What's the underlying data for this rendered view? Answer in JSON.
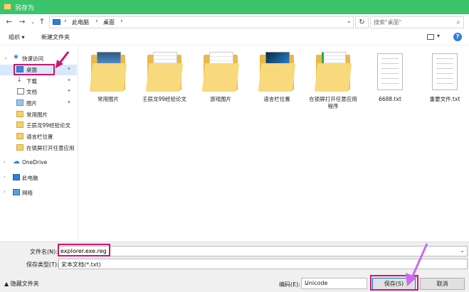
{
  "window": {
    "title": "另存为"
  },
  "address": {
    "crumbs": [
      "此电脑",
      "桌面"
    ],
    "search_placeholder": "搜索\"桌面\""
  },
  "toolbar": {
    "organize": "组织 ▾",
    "new_folder": "新建文件夹"
  },
  "sidebar": {
    "items": [
      {
        "label": "快速访问",
        "icon": "star-icon"
      },
      {
        "label": "桌面",
        "icon": "desktop-icon",
        "pinned": true,
        "selected": true
      },
      {
        "label": "下载",
        "icon": "download-icon",
        "pinned": true
      },
      {
        "label": "文档",
        "icon": "document-icon",
        "pinned": true
      },
      {
        "label": "图片",
        "icon": "picture-icon",
        "pinned": true
      },
      {
        "label": "常用图片",
        "icon": "folder-icon"
      },
      {
        "label": "壬辰龙99经验论文",
        "icon": "folder-icon"
      },
      {
        "label": "语言栏位置",
        "icon": "folder-icon"
      },
      {
        "label": "在锁屏打开任意应用",
        "icon": "folder-icon"
      },
      {
        "label": "OneDrive",
        "icon": "cloud-icon"
      },
      {
        "label": "此电脑",
        "icon": "computer-icon"
      },
      {
        "label": "网络",
        "icon": "network-icon"
      }
    ]
  },
  "files": [
    {
      "name": "常用图片",
      "type": "folder"
    },
    {
      "name": "壬辰龙99经验论文",
      "type": "folder"
    },
    {
      "name": "游戏图片",
      "type": "folder"
    },
    {
      "name": "语言栏位置",
      "type": "folder"
    },
    {
      "name": "在锁屏打开任意应用程序",
      "type": "folder"
    },
    {
      "name": "6688.txt",
      "type": "txt"
    },
    {
      "name": "重要文件.txt",
      "type": "txt"
    }
  ],
  "form": {
    "filename_label": "文件名(N):",
    "filename_value": "explorer.exe.reg",
    "filetype_label": "保存类型(T):",
    "filetype_value": "文本文档(*.txt)",
    "hide_folders": "▲ 隐藏文件夹",
    "encoding_label": "编码(E):",
    "encoding_value": "Unicode",
    "save_label": "保存(S)",
    "cancel_label": "取消"
  },
  "colors": {
    "titlebar": "#3cc46c",
    "highlight": "#d0156d",
    "arrow": "#c86cf0"
  }
}
